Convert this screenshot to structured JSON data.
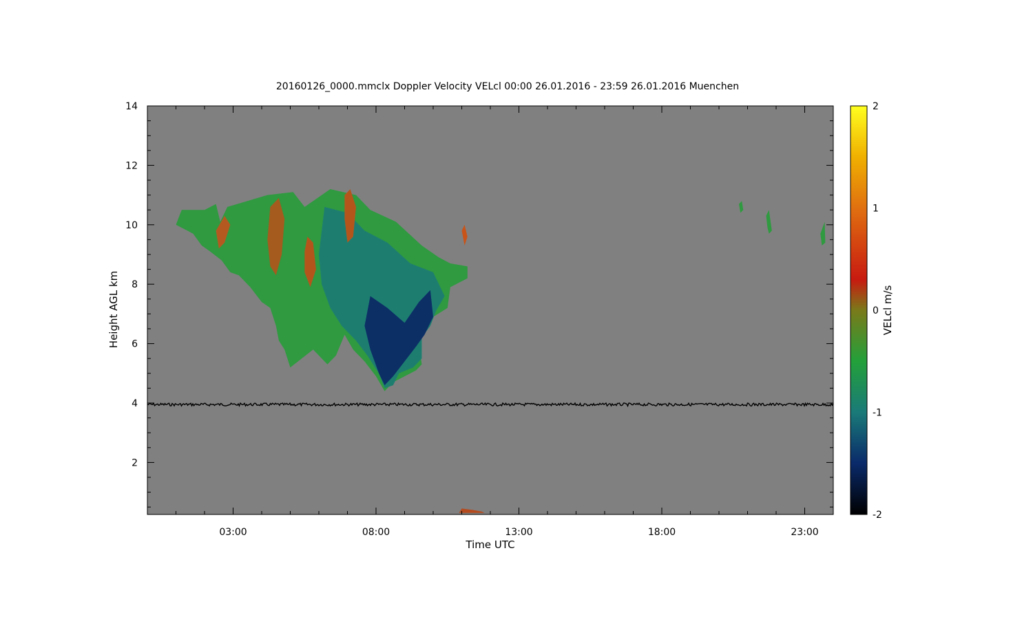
{
  "chart_data": {
    "type": "heatmap",
    "title": "20160126_0000.mmclx Doppler Velocity VELcl   00:00 26.01.2016 - 23:59 26.01.2016 Muenchen",
    "xlabel": "Time UTC",
    "ylabel": "Height AGL km",
    "x_unit": "hours UTC",
    "xlim": [
      0,
      24
    ],
    "ylim": [
      0.25,
      14
    ],
    "x_ticks": [
      {
        "value": 3,
        "label": "03:00"
      },
      {
        "value": 8,
        "label": "08:00"
      },
      {
        "value": 13,
        "label": "13:00"
      },
      {
        "value": 18,
        "label": "18:00"
      },
      {
        "value": 23,
        "label": "23:00"
      }
    ],
    "y_ticks": [
      {
        "value": 2,
        "label": "2"
      },
      {
        "value": 4,
        "label": "4"
      },
      {
        "value": 6,
        "label": "6"
      },
      {
        "value": 8,
        "label": "8"
      },
      {
        "value": 10,
        "label": "10"
      },
      {
        "value": 12,
        "label": "12"
      },
      {
        "value": 14,
        "label": "14"
      }
    ],
    "background_color": "#808080",
    "colorbar": {
      "label": "VELcl m/s",
      "range": [
        -2,
        2
      ],
      "ticks": [
        {
          "value": 2,
          "label": "2"
        },
        {
          "value": 1,
          "label": "1"
        },
        {
          "value": 0,
          "label": "0"
        },
        {
          "value": -1,
          "label": "-1"
        },
        {
          "value": -2,
          "label": "-2"
        }
      ],
      "stops": [
        {
          "value": -2,
          "color": "#000000"
        },
        {
          "value": -1.5,
          "color": "#0a2a6a"
        },
        {
          "value": -1,
          "color": "#1a7a78"
        },
        {
          "value": -0.5,
          "color": "#23a03a"
        },
        {
          "value": 0,
          "color": "#7a7a1a"
        },
        {
          "value": 0.3,
          "color": "#c81a10"
        },
        {
          "value": 1,
          "color": "#e07010"
        },
        {
          "value": 1.5,
          "color": "#f0b000"
        },
        {
          "value": 2,
          "color": "#ffff20"
        }
      ]
    },
    "echo_regions": [
      {
        "name": "main-cloud",
        "color": "#2f9a40",
        "points": [
          [
            2.55,
            10.1
          ],
          [
            2.8,
            10.6
          ],
          [
            3.5,
            10.8
          ],
          [
            4.2,
            11.0
          ],
          [
            5.1,
            11.1
          ],
          [
            5.5,
            10.6
          ],
          [
            6.4,
            11.2
          ],
          [
            7.3,
            11.0
          ],
          [
            7.8,
            10.5
          ],
          [
            8.7,
            10.1
          ],
          [
            9.6,
            9.3
          ],
          [
            10.2,
            8.9
          ],
          [
            10.6,
            8.7
          ],
          [
            11.2,
            8.6
          ],
          [
            11.2,
            8.2
          ],
          [
            10.6,
            7.9
          ],
          [
            10.5,
            7.2
          ],
          [
            10.0,
            6.9
          ],
          [
            9.8,
            6.6
          ],
          [
            9.5,
            6.0
          ],
          [
            9.6,
            5.3
          ],
          [
            9.4,
            5.1
          ],
          [
            9.0,
            4.9
          ],
          [
            8.6,
            4.7
          ],
          [
            8.3,
            4.4
          ],
          [
            8.0,
            4.9
          ],
          [
            7.6,
            5.4
          ],
          [
            7.2,
            5.8
          ],
          [
            6.9,
            6.3
          ],
          [
            6.6,
            5.6
          ],
          [
            6.3,
            5.3
          ],
          [
            5.8,
            5.8
          ],
          [
            5.4,
            5.5
          ],
          [
            5.0,
            5.2
          ],
          [
            4.8,
            5.8
          ],
          [
            4.6,
            6.1
          ],
          [
            4.5,
            6.6
          ],
          [
            4.3,
            7.2
          ],
          [
            4.0,
            7.4
          ],
          [
            3.6,
            7.9
          ],
          [
            3.2,
            8.3
          ],
          [
            2.9,
            8.4
          ],
          [
            2.6,
            8.8
          ],
          [
            2.2,
            9.1
          ],
          [
            1.9,
            9.3
          ],
          [
            1.6,
            9.7
          ],
          [
            1.0,
            10.0
          ],
          [
            1.2,
            10.5
          ],
          [
            2.0,
            10.5
          ],
          [
            2.4,
            10.7
          ]
        ]
      },
      {
        "name": "turbulent-fallstreak",
        "color": "#1d7e70",
        "points": [
          [
            6.2,
            10.6
          ],
          [
            7.0,
            10.4
          ],
          [
            7.6,
            9.8
          ],
          [
            8.4,
            9.4
          ],
          [
            9.2,
            8.7
          ],
          [
            10.0,
            8.4
          ],
          [
            10.4,
            7.6
          ],
          [
            10.1,
            7.1
          ],
          [
            9.9,
            6.6
          ],
          [
            9.6,
            6.2
          ],
          [
            9.6,
            5.5
          ],
          [
            9.3,
            5.2
          ],
          [
            8.8,
            5.0
          ],
          [
            8.6,
            4.6
          ],
          [
            8.3,
            4.5
          ],
          [
            8.1,
            5.0
          ],
          [
            7.7,
            5.6
          ],
          [
            7.3,
            6.1
          ],
          [
            6.8,
            6.6
          ],
          [
            6.4,
            7.2
          ],
          [
            6.1,
            8.0
          ],
          [
            6.0,
            9.0
          ]
        ]
      },
      {
        "name": "strong-fallstreak-core",
        "color": "#0c2f66",
        "points": [
          [
            7.8,
            7.6
          ],
          [
            8.4,
            7.2
          ],
          [
            9.0,
            6.7
          ],
          [
            9.5,
            7.4
          ],
          [
            9.9,
            7.8
          ],
          [
            10.0,
            6.9
          ],
          [
            9.7,
            6.3
          ],
          [
            9.4,
            5.9
          ],
          [
            9.0,
            5.4
          ],
          [
            8.6,
            4.9
          ],
          [
            8.3,
            4.6
          ],
          [
            8.1,
            5.0
          ],
          [
            7.8,
            5.8
          ],
          [
            7.6,
            6.6
          ]
        ]
      },
      {
        "name": "updraft-west",
        "color": "#b45a20",
        "points": [
          [
            2.4,
            9.8
          ],
          [
            2.7,
            10.3
          ],
          [
            2.9,
            10.0
          ],
          [
            2.7,
            9.4
          ],
          [
            2.5,
            9.2
          ]
        ]
      },
      {
        "name": "updraft-central",
        "color": "#a55b1e",
        "points": [
          [
            4.3,
            10.6
          ],
          [
            4.6,
            10.9
          ],
          [
            4.8,
            10.2
          ],
          [
            4.7,
            9.0
          ],
          [
            4.5,
            8.3
          ],
          [
            4.3,
            8.6
          ],
          [
            4.2,
            9.5
          ]
        ]
      },
      {
        "name": "updraft-east",
        "color": "#b4561c",
        "points": [
          [
            5.6,
            9.6
          ],
          [
            5.8,
            9.4
          ],
          [
            5.9,
            8.5
          ],
          [
            5.7,
            7.9
          ],
          [
            5.5,
            8.4
          ],
          [
            5.5,
            9.1
          ]
        ]
      },
      {
        "name": "updraft-cloudtop",
        "color": "#b4561c",
        "points": [
          [
            6.9,
            11.0
          ],
          [
            7.1,
            11.2
          ],
          [
            7.3,
            10.6
          ],
          [
            7.2,
            9.6
          ],
          [
            7.0,
            9.4
          ],
          [
            6.9,
            10.2
          ]
        ]
      },
      {
        "name": "updraft-edge",
        "color": "#c8541a",
        "points": [
          [
            11.0,
            9.8
          ],
          [
            11.1,
            10.0
          ],
          [
            11.2,
            9.6
          ],
          [
            11.1,
            9.3
          ]
        ]
      },
      {
        "name": "late-cirrus-1",
        "color": "#2f9a40",
        "points": [
          [
            20.7,
            10.7
          ],
          [
            20.8,
            10.8
          ],
          [
            20.85,
            10.5
          ],
          [
            20.75,
            10.4
          ]
        ]
      },
      {
        "name": "late-cirrus-2",
        "color": "#2f9a40",
        "points": [
          [
            21.65,
            10.3
          ],
          [
            21.75,
            10.5
          ],
          [
            21.85,
            9.8
          ],
          [
            21.75,
            9.7
          ],
          [
            21.7,
            9.9
          ]
        ]
      },
      {
        "name": "late-cirrus-3",
        "color": "#2f9a40",
        "points": [
          [
            23.55,
            9.7
          ],
          [
            23.7,
            10.1
          ],
          [
            23.72,
            9.4
          ],
          [
            23.6,
            9.3
          ]
        ]
      },
      {
        "name": "surface-clutter",
        "color": "#b44a1e",
        "points": [
          [
            10.9,
            0.3
          ],
          [
            11.0,
            0.45
          ],
          [
            11.4,
            0.4
          ],
          [
            11.7,
            0.35
          ],
          [
            11.8,
            0.3
          ]
        ]
      }
    ],
    "noise_line": {
      "name": "artifact-line-4km",
      "height_km": 3.95,
      "color": "#000000"
    }
  }
}
